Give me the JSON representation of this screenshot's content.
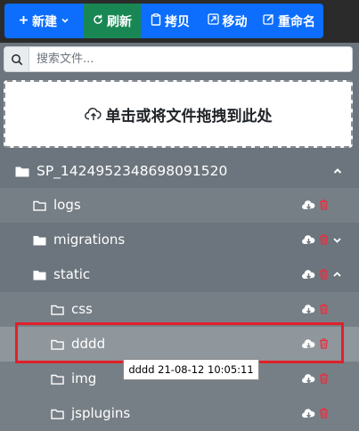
{
  "toolbar": {
    "new_label": "新建",
    "refresh_label": "刷新",
    "copy_label": "拷贝",
    "move_label": "移动",
    "rename_label": "重命名"
  },
  "search": {
    "placeholder": "搜索文件..."
  },
  "dropzone": {
    "label": "单击或将文件拖拽到此处"
  },
  "tree": {
    "root": {
      "name": "SP_1424952348698091520",
      "expanded": true
    },
    "items": [
      {
        "name": "logs"
      },
      {
        "name": "migrations",
        "expanded": false
      },
      {
        "name": "static",
        "expanded": true
      },
      {
        "name": "css"
      },
      {
        "name": "dddd",
        "selected": true
      },
      {
        "name": "img"
      },
      {
        "name": "jsplugins"
      }
    ]
  },
  "tooltip": {
    "text": "dddd 21-08-12 10:05:11"
  },
  "colors": {
    "primary": "#0d6efd",
    "success": "#198754",
    "danger": "#dc3545",
    "highlight": "#e0202a"
  },
  "icons": [
    "plus-icon",
    "chevron-down-icon",
    "refresh-icon",
    "copy-icon",
    "move-icon",
    "edit-icon",
    "search-icon",
    "cloud-upload-icon",
    "folder-icon",
    "cloud-download-icon",
    "trash-icon",
    "chevron-up-icon"
  ]
}
